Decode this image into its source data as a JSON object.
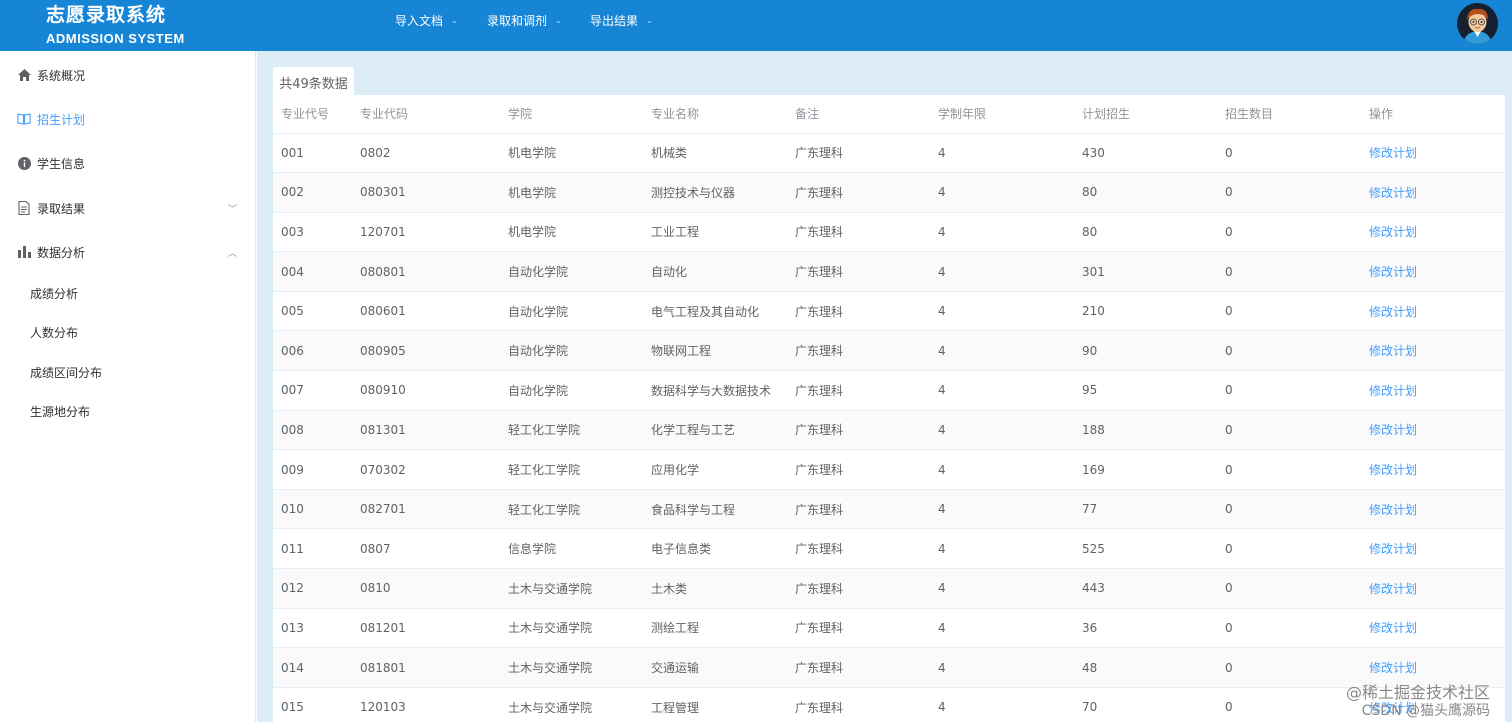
{
  "header": {
    "title": "志愿录取系统",
    "subtitle": "ADMISSION SYSTEM",
    "nav": [
      {
        "label": "导入文档"
      },
      {
        "label": "录取和调剂"
      },
      {
        "label": "导出结果"
      }
    ]
  },
  "sidebar": {
    "items": [
      {
        "label": "系统概况",
        "icon": "home-icon"
      },
      {
        "label": "招生计划",
        "icon": "book-icon",
        "active": true
      },
      {
        "label": "学生信息",
        "icon": "info-icon"
      },
      {
        "label": "录取结果",
        "icon": "document-icon",
        "expandable": true
      },
      {
        "label": "数据分析",
        "icon": "bar-chart-icon",
        "expanded": true
      }
    ],
    "subitems": [
      "成绩分析",
      "人数分布",
      "成绩区间分布",
      "生源地分布"
    ]
  },
  "main": {
    "tab_label": "共49条数据",
    "columns": [
      "专业代号",
      "专业代码",
      "学院",
      "专业名称",
      "备注",
      "学制年限",
      "计划招生",
      "招生数目",
      "操作"
    ],
    "action_label": "修改计划",
    "rows": [
      [
        "001",
        "0802",
        "机电学院",
        "机械类",
        "广东理科",
        "4",
        "430",
        "0"
      ],
      [
        "002",
        "080301",
        "机电学院",
        "测控技术与仪器",
        "广东理科",
        "4",
        "80",
        "0"
      ],
      [
        "003",
        "120701",
        "机电学院",
        "工业工程",
        "广东理科",
        "4",
        "80",
        "0"
      ],
      [
        "004",
        "080801",
        "自动化学院",
        "自动化",
        "广东理科",
        "4",
        "301",
        "0"
      ],
      [
        "005",
        "080601",
        "自动化学院",
        "电气工程及其自动化",
        "广东理科",
        "4",
        "210",
        "0"
      ],
      [
        "006",
        "080905",
        "自动化学院",
        "物联网工程",
        "广东理科",
        "4",
        "90",
        "0"
      ],
      [
        "007",
        "080910",
        "自动化学院",
        "数据科学与大数据技术",
        "广东理科",
        "4",
        "95",
        "0"
      ],
      [
        "008",
        "081301",
        "轻工化工学院",
        "化学工程与工艺",
        "广东理科",
        "4",
        "188",
        "0"
      ],
      [
        "009",
        "070302",
        "轻工化工学院",
        "应用化学",
        "广东理科",
        "4",
        "169",
        "0"
      ],
      [
        "010",
        "082701",
        "轻工化工学院",
        "食品科学与工程",
        "广东理科",
        "4",
        "77",
        "0"
      ],
      [
        "011",
        "0807",
        "信息学院",
        "电子信息类",
        "广东理科",
        "4",
        "525",
        "0"
      ],
      [
        "012",
        "0810",
        "土木与交通学院",
        "土木类",
        "广东理科",
        "4",
        "443",
        "0"
      ],
      [
        "013",
        "081201",
        "土木与交通学院",
        "测绘工程",
        "广东理科",
        "4",
        "36",
        "0"
      ],
      [
        "014",
        "081801",
        "土木与交通学院",
        "交通运输",
        "广东理科",
        "4",
        "48",
        "0"
      ],
      [
        "015",
        "120103",
        "土木与交通学院",
        "工程管理",
        "广东理科",
        "4",
        "70",
        "0"
      ]
    ]
  },
  "watermark": {
    "line1": "@稀土掘金技术社区",
    "line2": "CSDN @猫头鹰源码"
  },
  "colors": {
    "header_bg": "#1685d6",
    "accent": "#409eff",
    "content_bg": "#dcedf8"
  }
}
